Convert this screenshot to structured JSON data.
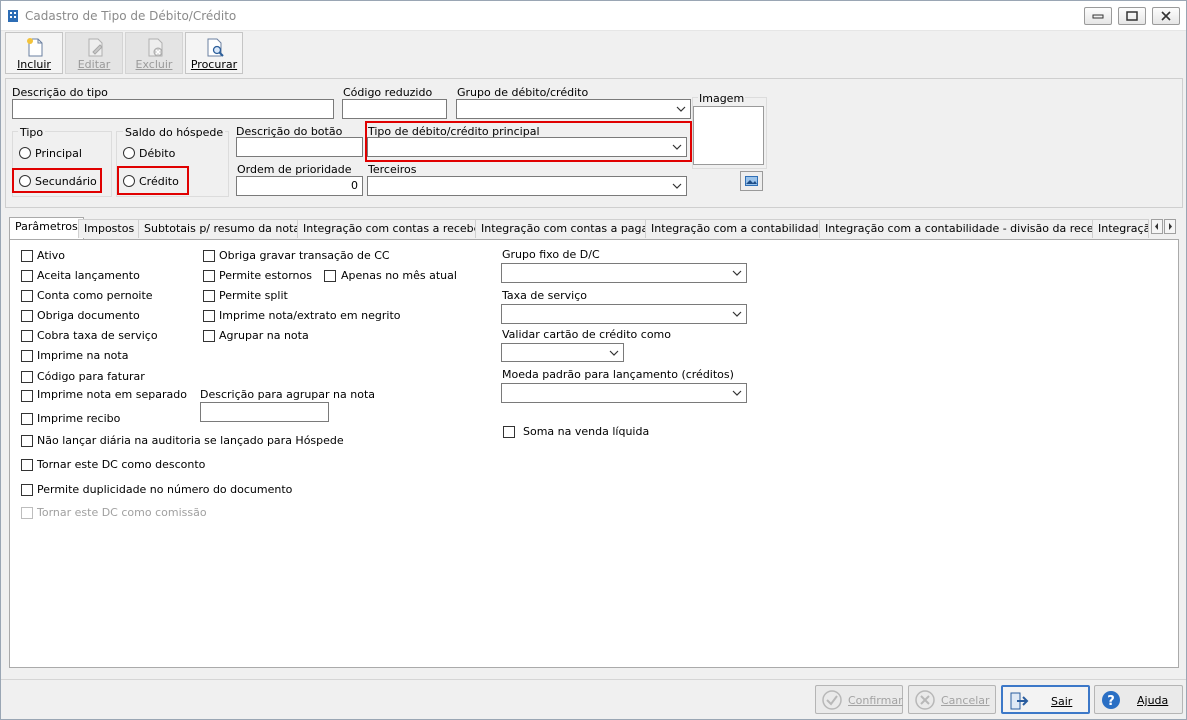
{
  "window": {
    "title": "Cadastro de Tipo de Débito/Crédito"
  },
  "toolbar": {
    "buttons": [
      {
        "label": "Incluir",
        "enabled": true
      },
      {
        "label": "Editar",
        "enabled": false
      },
      {
        "label": "Excluir",
        "enabled": false
      },
      {
        "label": "Procurar",
        "enabled": true
      }
    ]
  },
  "form": {
    "descricao_tipo_label": "Descrição do tipo",
    "descricao_tipo_value": "",
    "codigo_reduzido_label": "Código reduzido",
    "codigo_reduzido_value": "",
    "grupo_label": "Grupo de débito/crédito",
    "grupo_value": "",
    "imagem_label": "Imagem",
    "tipo_label": "Tipo",
    "tipo_options": [
      "Principal",
      "Secundário"
    ],
    "saldo_label": "Saldo do hóspede",
    "saldo_options": [
      "Débito",
      "Crédito"
    ],
    "descricao_botao_label": "Descrição do botão",
    "descricao_botao_value": "",
    "tipo_principal_label": "Tipo de débito/crédito principal",
    "tipo_principal_value": "",
    "ordem_label": "Ordem de prioridade",
    "ordem_value": "0",
    "terceiros_label": "Terceiros",
    "terceiros_value": ""
  },
  "tabs": [
    "Parâmetros",
    "Impostos",
    "Subtotais p/ resumo da nota",
    "Integração com contas a receber",
    "Integração com contas a pagar",
    "Integração com a contabilidade",
    "Integração com a contabilidade - divisão da receita",
    "Integraçã"
  ],
  "params": {
    "col1": [
      {
        "label": "Ativo",
        "checked": false,
        "enabled": true
      },
      {
        "label": "Aceita lançamento",
        "checked": false,
        "enabled": true
      },
      {
        "label": "Conta como pernoite",
        "checked": false,
        "enabled": true
      },
      {
        "label": "Obriga documento",
        "checked": false,
        "enabled": true
      },
      {
        "label": "Cobra taxa de serviço",
        "checked": false,
        "enabled": true
      },
      {
        "label": "Imprime na nota",
        "checked": false,
        "enabled": true
      },
      {
        "label": "Código para faturar",
        "checked": false,
        "enabled": true
      },
      {
        "label": "Imprime nota em separado",
        "checked": false,
        "enabled": true
      },
      {
        "label": "Imprime recibo",
        "checked": false,
        "enabled": true
      },
      {
        "label": "Não lançar diária na auditoria se lançado para Hóspede",
        "checked": false,
        "enabled": true
      },
      {
        "label": "Tornar este DC como desconto",
        "checked": false,
        "enabled": true
      },
      {
        "label": "Permite duplicidade no número do documento",
        "checked": false,
        "enabled": true
      },
      {
        "label": "Tornar este DC como comissão",
        "checked": false,
        "enabled": false
      }
    ],
    "col2": [
      {
        "label": "Obriga gravar transação de CC",
        "checked": false,
        "enabled": true
      },
      {
        "label": "Permite estornos",
        "checked": false,
        "enabled": true
      },
      {
        "label": "Apenas no mês atual",
        "checked": false,
        "enabled": true
      },
      {
        "label": "Permite split",
        "checked": false,
        "enabled": true
      },
      {
        "label": "Imprime nota/extrato em negrito",
        "checked": false,
        "enabled": true
      },
      {
        "label": "Agrupar na nota",
        "checked": false,
        "enabled": true
      }
    ],
    "agrupar_desc_label": "Descrição para agrupar na nota",
    "agrupar_desc_value": "",
    "grupo_fixo_label": "Grupo fixo de D/C",
    "taxa_servico_label": "Taxa de serviço",
    "validar_cartao_label": "Validar cartão de crédito como",
    "moeda_label": "Moeda padrão para lançamento (créditos)",
    "soma_venda_label": "Soma na venda líquida"
  },
  "footer": {
    "confirmar": "Confirmar",
    "cancelar": "Cancelar",
    "sair": "Sair",
    "ajuda": "Ajuda"
  },
  "colors": {
    "highlight": "#e00000",
    "primary_border": "#3c78c8"
  }
}
